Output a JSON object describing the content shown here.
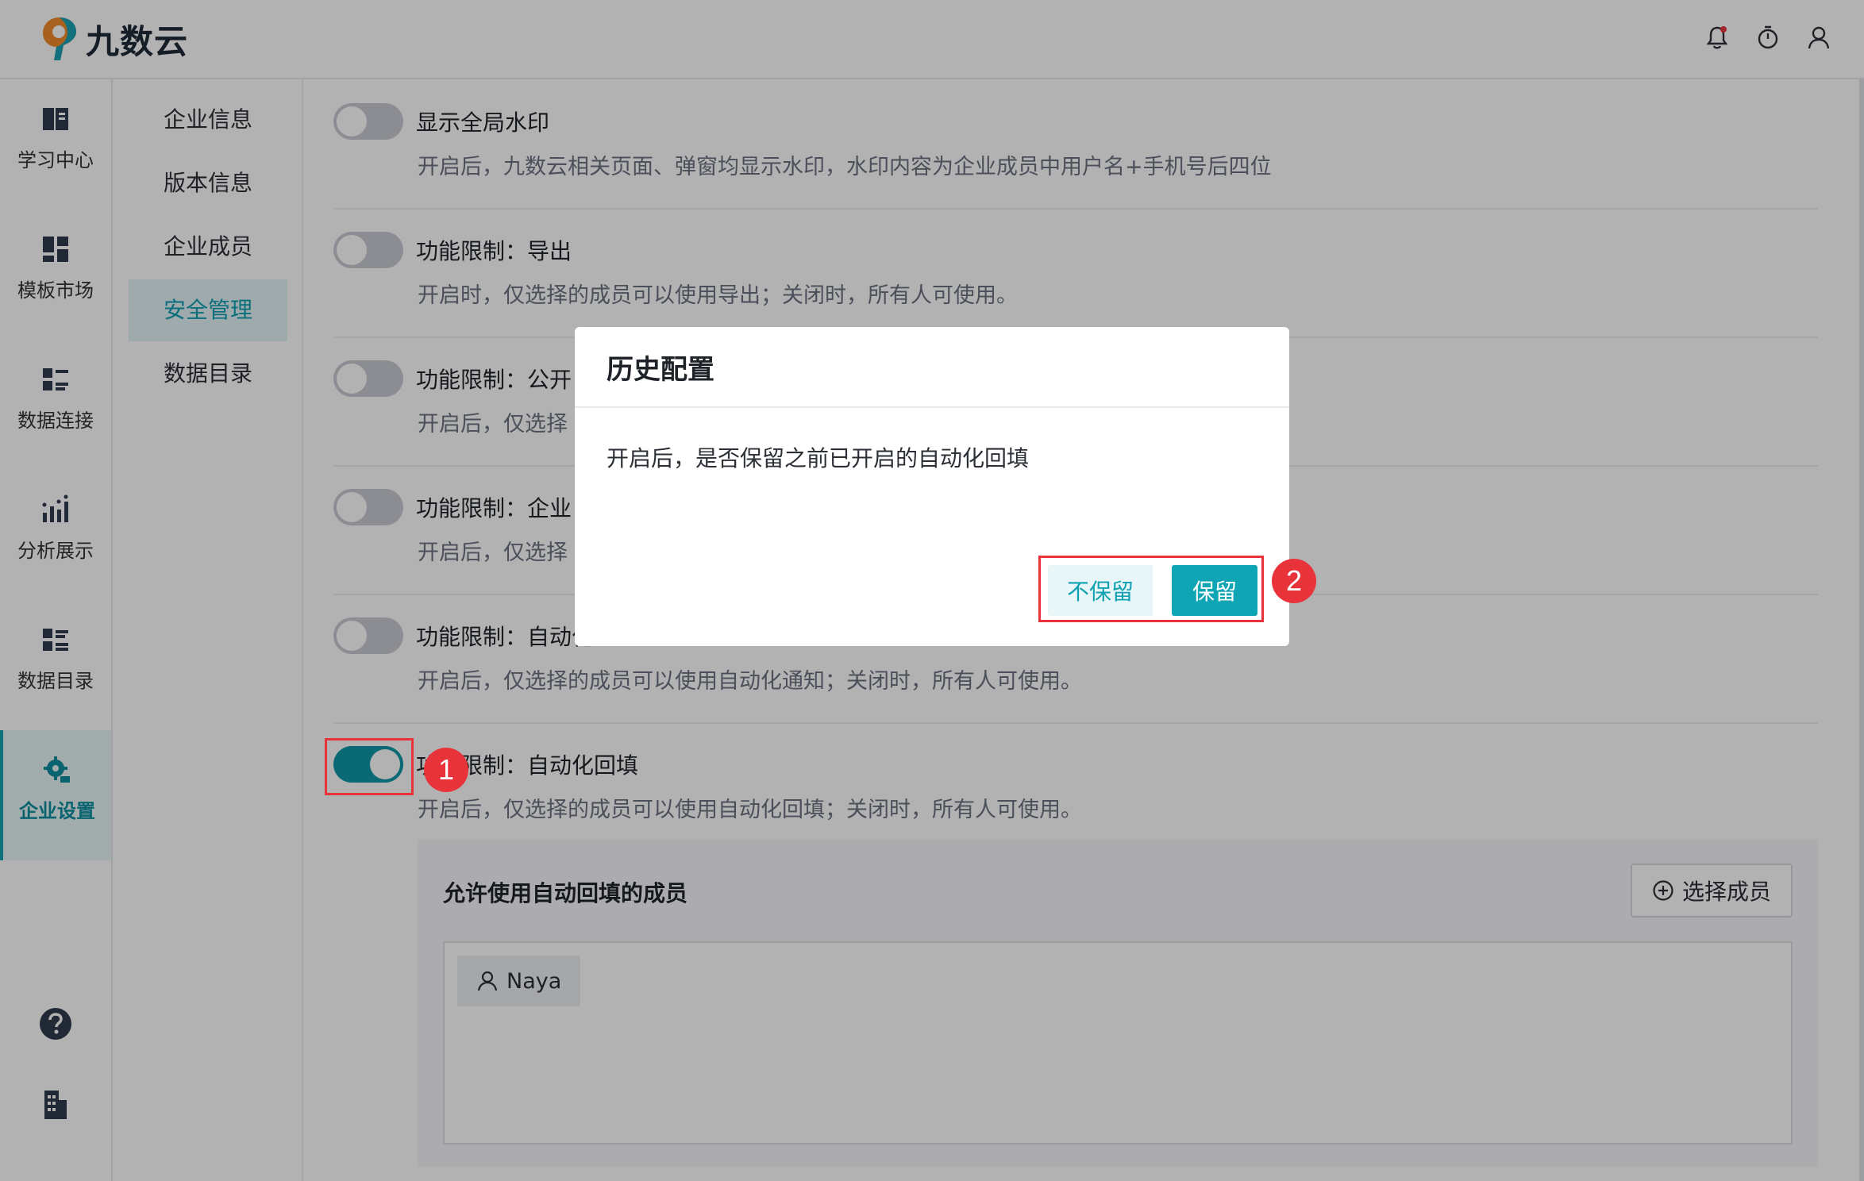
{
  "app": {
    "logo_text": "九数云"
  },
  "header": {
    "icons": [
      "bell-icon",
      "timer-icon",
      "user-icon"
    ]
  },
  "leftnav": {
    "items": [
      {
        "label": "学习中心",
        "icon": "book-icon"
      },
      {
        "label": "模板市场",
        "icon": "template-icon"
      },
      {
        "label": "数据连接",
        "icon": "connection-icon"
      },
      {
        "label": "分析展示",
        "icon": "chart-icon"
      },
      {
        "label": "数据目录",
        "icon": "catalog-icon"
      },
      {
        "label": "企业设置",
        "icon": "settings-icon"
      }
    ],
    "bottom_icons": [
      "help-icon",
      "building-icon"
    ]
  },
  "subnav": {
    "items": [
      {
        "label": "企业信息"
      },
      {
        "label": "版本信息"
      },
      {
        "label": "企业成员"
      },
      {
        "label": "安全管理"
      },
      {
        "label": "数据目录"
      }
    ]
  },
  "settings": [
    {
      "title": "显示全局水印",
      "desc": "开启后，九数云相关页面、弹窗均显示水印，水印内容为企业成员中用户名+手机号后四位",
      "on": false
    },
    {
      "title": "功能限制：导出",
      "desc": "开启时，仅选择的成员可以使用导出；关闭时，所有人可使用。",
      "on": false
    },
    {
      "title": "功能限制：公开",
      "desc": "开启后，仅选择",
      "on": false
    },
    {
      "title": "功能限制：企业",
      "desc": "开启后，仅选择",
      "on": false
    },
    {
      "title": "功能限制：自动化通知",
      "desc": "开启后，仅选择的成员可以使用自动化通知；关闭时，所有人可使用。",
      "on": false
    },
    {
      "title": "功能限制：自动化回填",
      "desc": "开启后，仅选择的成员可以使用自动化回填；关闭时，所有人可使用。",
      "on": true
    }
  ],
  "members": {
    "title": "允许使用自动回填的成员",
    "select_button": "选择成员",
    "list": [
      "Naya"
    ]
  },
  "dialog": {
    "title": "历史配置",
    "body": "开启后，是否保留之前已开启的自动化回填",
    "cancel_label": "不保留",
    "confirm_label": "保留"
  },
  "annotations": {
    "badge_1": "1",
    "badge_2": "2"
  },
  "colors": {
    "accent": "#10a5b5",
    "annotation": "#e8333a"
  }
}
